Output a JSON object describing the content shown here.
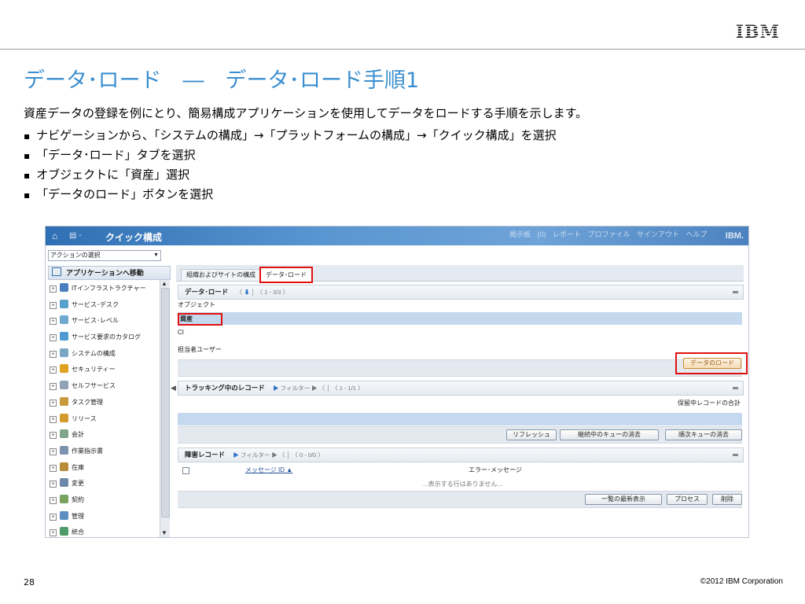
{
  "slide": {
    "logo": "IBM",
    "title": "データ･ロード　―　データ･ロード手順1",
    "intro": "資産データの登録を例にとり、簡易構成アプリケーションを使用してデータをロードする手順を示します。",
    "bullets": [
      "ナビゲーションから、「システムの構成」→「プラットフォームの構成」→「クイック構成」を選択",
      "「データ･ロード」タブを選択",
      "オブジェクトに「資産」選択",
      "「データのロード」ボタンを選択"
    ],
    "page_number": "28",
    "copyright": "©2012 IBM Corporation"
  },
  "app": {
    "title": "クイック構成",
    "header_links": "掲示板 (0)  レポート  プロファイル  サインアウト  ヘルプ",
    "header_logo": "IBM.",
    "action_select": "アクションの選択",
    "nav_header": "アプリケーションへ移動",
    "nav_items": [
      {
        "label": "ITインフラストラクチャー",
        "icon": "server-icon",
        "color": "#4a7fbf"
      },
      {
        "label": "サービス･デスク",
        "icon": "service-desk-icon",
        "color": "#5aa0c8"
      },
      {
        "label": "サービス･レベル",
        "icon": "service-level-icon",
        "color": "#6ea8cf"
      },
      {
        "label": "サービス要求のカタログ",
        "icon": "catalog-icon",
        "color": "#4f9bd0"
      },
      {
        "label": "システムの構成",
        "icon": "system-config-icon",
        "color": "#7aa6c6"
      },
      {
        "label": "セキュリティー",
        "icon": "lock-icon",
        "color": "#e0a020"
      },
      {
        "label": "セルフサービス",
        "icon": "self-service-icon",
        "color": "#8fa3b5"
      },
      {
        "label": "タスク管理",
        "icon": "task-icon",
        "color": "#c99a3c"
      },
      {
        "label": "リリース",
        "icon": "release-icon",
        "color": "#d39a2c"
      },
      {
        "label": "会計",
        "icon": "accounting-icon",
        "color": "#7fa58a"
      },
      {
        "label": "作業指示書",
        "icon": "work-order-icon",
        "color": "#7c92ad"
      },
      {
        "label": "在庫",
        "icon": "inventory-icon",
        "color": "#b88b3a"
      },
      {
        "label": "変更",
        "icon": "change-icon",
        "color": "#6c87a8"
      },
      {
        "label": "契約",
        "icon": "contract-icon",
        "color": "#7aa35f"
      },
      {
        "label": "管理",
        "icon": "admin-icon",
        "color": "#5e8fc4"
      },
      {
        "label": "統合",
        "icon": "integration-icon",
        "color": "#4f9b6a"
      }
    ],
    "tabs": [
      "組織およびサイトの構成",
      "データ･ロード"
    ],
    "data_load": {
      "header": "データ･ロード",
      "pager": "1 - 3/3",
      "column_header": "オブジェクト",
      "rows": [
        "資産",
        "CI",
        "担当者ユーザー"
      ],
      "load_button": "データのロード"
    },
    "tracking": {
      "header": "トラッキング中のレコード",
      "filter": "フィルター",
      "pager": "1 - 1/1",
      "total_label": "保留中レコードの合計",
      "buttons": [
        "リフレッシュ",
        "継続中のキューの消去",
        "順次キューの消去"
      ]
    },
    "error_records": {
      "header": "障害レコード",
      "filter": "フィルター",
      "pager": "0 - 0/0",
      "col_message": "メッセージ ID",
      "col_error": "エラー･メッセージ",
      "empty": "...表示する行はありません...",
      "buttons": [
        "一覧の最新表示",
        "プロセス",
        "削除"
      ]
    }
  }
}
